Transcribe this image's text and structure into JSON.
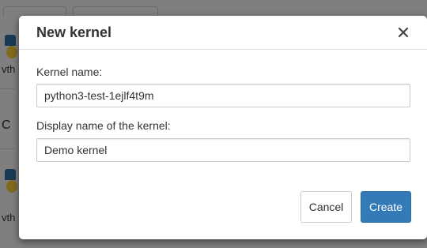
{
  "background": {
    "partial_texts": [
      "vth",
      "C",
      "vth"
    ]
  },
  "dialog": {
    "title": "New kernel",
    "close_glyph": "×",
    "kernel_name": {
      "label": "Kernel name:",
      "value": "python3-test-1ejlf4t9m"
    },
    "display_name": {
      "label": "Display name of the kernel:",
      "value": "Demo kernel"
    },
    "buttons": {
      "cancel": "Cancel",
      "create": "Create"
    }
  },
  "colors": {
    "primary": "#337ab7",
    "primary_border": "#2e6da4",
    "overlay": "rgba(0,0,0,0.5)",
    "text": "#333333"
  },
  "icons": {
    "close": "close-icon",
    "logo": "python-logo-icon"
  }
}
